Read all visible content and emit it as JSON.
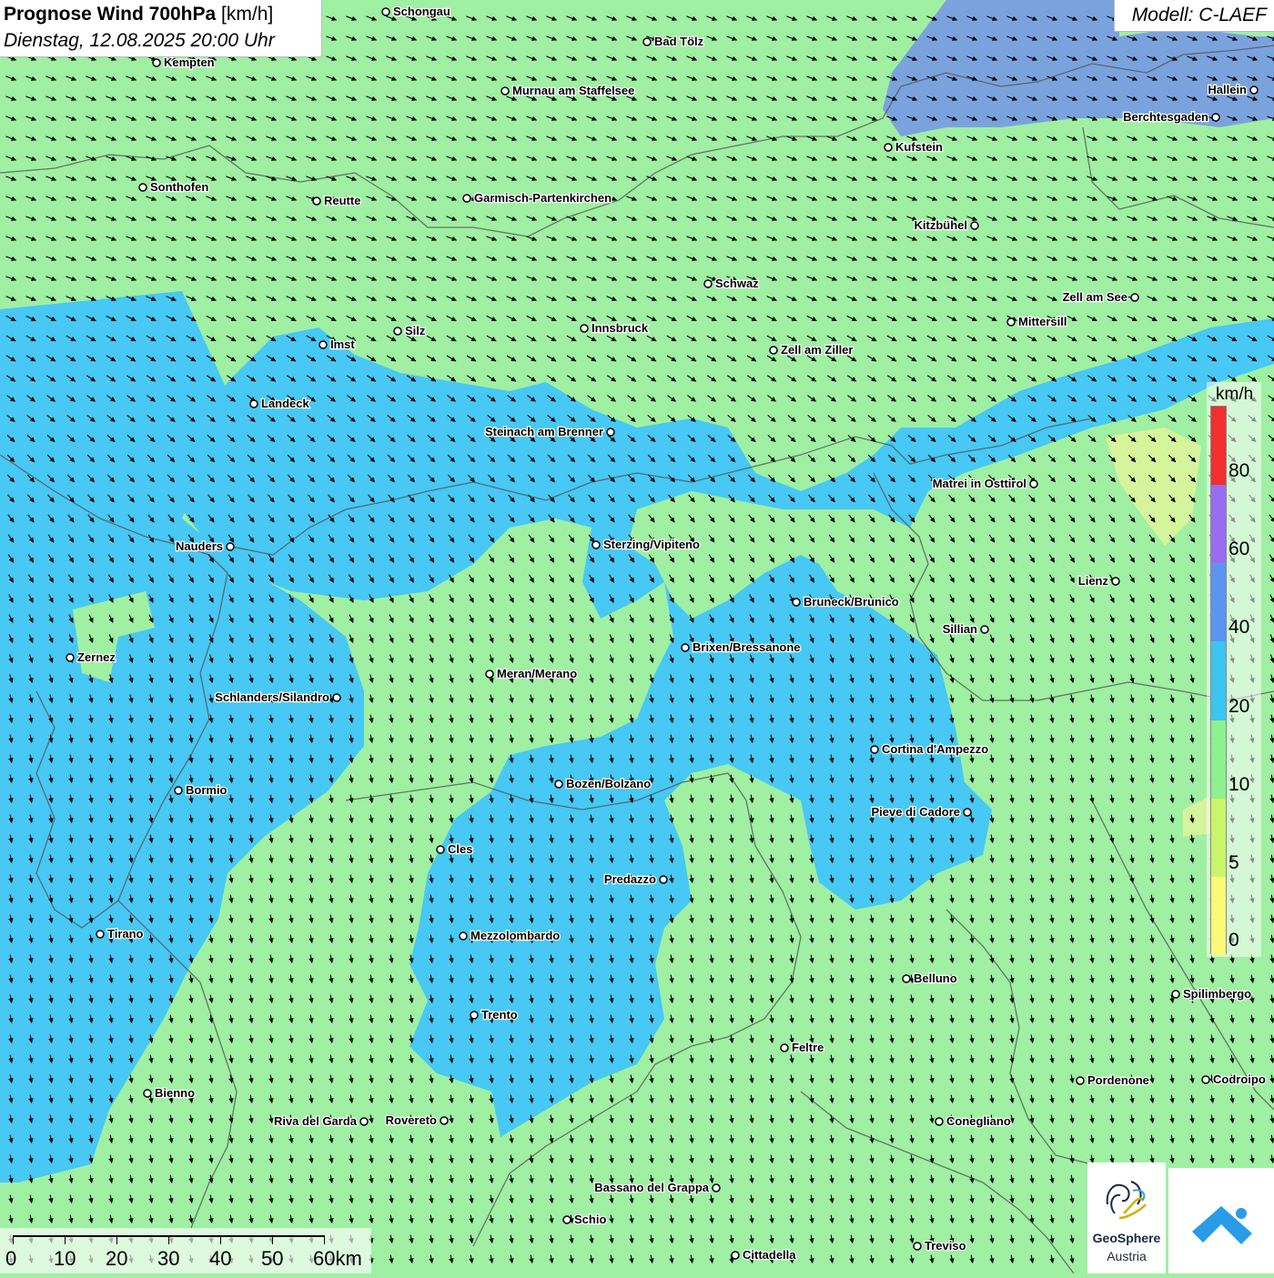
{
  "title": {
    "main_bold": "Prognose Wind 700hPa",
    "unit": "[km/h]",
    "datetime": "Dienstag, 12.08.2025 20:00 Uhr"
  },
  "model": "Modell: C-LAEF",
  "legend": {
    "unit": "km/h",
    "ticks": [
      "80",
      "60",
      "40",
      "20",
      "10",
      "5",
      "0"
    ],
    "colors": [
      "#f03030",
      "#9a6cf0",
      "#5b94f0",
      "#3cc4f2",
      "#8ef08e",
      "#c9f56a",
      "#fafa78"
    ]
  },
  "scale_bar": {
    "labels": [
      "0",
      "10",
      "20",
      "30",
      "40",
      "50",
      "60km"
    ]
  },
  "logos": {
    "geosphere_line1": "GeoSphere",
    "geosphere_line2": "Austria",
    "weather_icon": "mountain-cloud-icon"
  },
  "colors": {
    "land_green": "#9ff0a2",
    "wind_blue": "#47c8f5",
    "wind_purple": "#6d8af0",
    "wind_yellow": "#dff59a",
    "border": "#555555"
  },
  "cities": [
    {
      "name": "Schongau"
    },
    {
      "name": "Bad Tölz"
    },
    {
      "name": "Kempten"
    },
    {
      "name": "Murnau am Staffelsee"
    },
    {
      "name": "Hallein"
    },
    {
      "name": "Berchtesgaden"
    },
    {
      "name": "Kufstein"
    },
    {
      "name": "Sonthofen"
    },
    {
      "name": "Reutte"
    },
    {
      "name": "Garmisch-Partenkirchen"
    },
    {
      "name": "Kitzbühel"
    },
    {
      "name": "Schwaz"
    },
    {
      "name": "Zell am See"
    },
    {
      "name": "Mittersill"
    },
    {
      "name": "Silz"
    },
    {
      "name": "Innsbruck"
    },
    {
      "name": "Imst"
    },
    {
      "name": "Zell am Ziller"
    },
    {
      "name": "Landeck"
    },
    {
      "name": "Steinach am Brenner"
    },
    {
      "name": "Matrei in Osttirol"
    },
    {
      "name": "Nauders"
    },
    {
      "name": "Sterzing/Vipiteno"
    },
    {
      "name": "Lienz"
    },
    {
      "name": "Bruneck/Brunico"
    },
    {
      "name": "Sillian"
    },
    {
      "name": "Zernez"
    },
    {
      "name": "Brixen/Bressanone"
    },
    {
      "name": "Meran/Merano"
    },
    {
      "name": "Schlanders/Silandro"
    },
    {
      "name": "Cortina d'Ampezzo"
    },
    {
      "name": "Bormio"
    },
    {
      "name": "Bozen/Bolzano"
    },
    {
      "name": "Pieve di Cadore"
    },
    {
      "name": "Cles"
    },
    {
      "name": "Predazzo"
    },
    {
      "name": "Tirano"
    },
    {
      "name": "Mezzolombardo"
    },
    {
      "name": "Belluno"
    },
    {
      "name": "Spilimbergo"
    },
    {
      "name": "Trento"
    },
    {
      "name": "Feltre"
    },
    {
      "name": "Bienno"
    },
    {
      "name": "Pordenone"
    },
    {
      "name": "Codroipo"
    },
    {
      "name": "Riva del Garda"
    },
    {
      "name": "Rovereto"
    },
    {
      "name": "Conegliano"
    },
    {
      "name": "Bassano del Grappa"
    },
    {
      "name": "Schio"
    },
    {
      "name": "Treviso"
    },
    {
      "name": "Cittadella"
    }
  ]
}
